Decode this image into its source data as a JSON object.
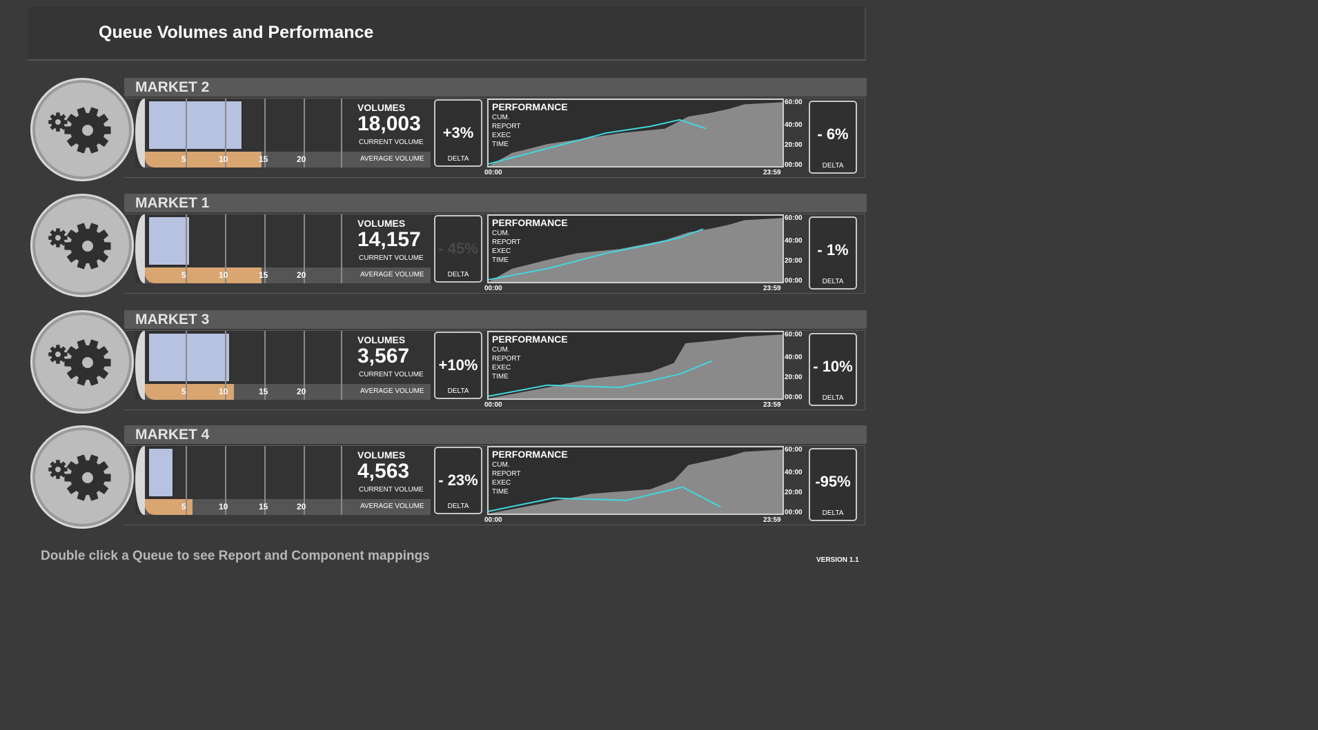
{
  "header": {
    "title": "Queue Volumes and Performance"
  },
  "labels": {
    "volumes": "VOLUMES",
    "current_volume": "CURRENT VOLUME",
    "average_volume": "AVERAGE VOLUME",
    "delta": "DELTA",
    "performance": "PERFORMANCE",
    "perf_sub": [
      "CUM.",
      "REPORT",
      "EXEC",
      "TIME"
    ],
    "ticks": [
      "5",
      "10",
      "15",
      "20"
    ],
    "y_ticks": [
      "60:00",
      "40:00",
      "20:00",
      "00:00"
    ],
    "x_ticks": [
      "00:00",
      "23:59"
    ]
  },
  "colors": {
    "current_bar": "#b7c1e0",
    "average_bar": "#d9a571",
    "area": "#8a8a8a",
    "line": "#3fd8e0"
  },
  "icons": {
    "queue": "gear-icon"
  },
  "markets": [
    {
      "name": "MARKET 2",
      "current_volume": "18,003",
      "volume_delta": "+3%",
      "perf_delta": "- 6%",
      "current_fraction": 0.345,
      "average_fraction": 0.34,
      "chart_data": {
        "type": "area",
        "x_range": [
          "00:00",
          "23:59"
        ],
        "y_ticks": [
          "00:00",
          "20:00",
          "40:00",
          "60:00"
        ],
        "area_points": [
          [
            0,
            0
          ],
          [
            8,
            12
          ],
          [
            20,
            20
          ],
          [
            30,
            24
          ],
          [
            45,
            30
          ],
          [
            60,
            34
          ],
          [
            68,
            45
          ],
          [
            75,
            48
          ],
          [
            82,
            52
          ],
          [
            87,
            56
          ],
          [
            100,
            58
          ]
        ],
        "line_points": [
          [
            0,
            2
          ],
          [
            20,
            16
          ],
          [
            40,
            30
          ],
          [
            55,
            36
          ],
          [
            65,
            42
          ],
          [
            74,
            34
          ]
        ]
      }
    },
    {
      "name": "MARKET 1",
      "current_volume": "14,157",
      "volume_delta": "- 45%",
      "perf_delta": "- 1%",
      "current_fraction": 0.155,
      "average_fraction": 0.34,
      "chart_data": {
        "type": "area",
        "x_range": [
          "00:00",
          "23:59"
        ],
        "y_ticks": [
          "00:00",
          "20:00",
          "40:00",
          "60:00"
        ],
        "area_points": [
          [
            0,
            0
          ],
          [
            8,
            12
          ],
          [
            20,
            20
          ],
          [
            30,
            26
          ],
          [
            45,
            30
          ],
          [
            60,
            38
          ],
          [
            68,
            45
          ],
          [
            75,
            48
          ],
          [
            82,
            52
          ],
          [
            87,
            56
          ],
          [
            100,
            58
          ]
        ],
        "line_points": [
          [
            0,
            2
          ],
          [
            20,
            12
          ],
          [
            40,
            26
          ],
          [
            55,
            34
          ],
          [
            65,
            40
          ],
          [
            73,
            48
          ]
        ]
      }
    },
    {
      "name": "MARKET 3",
      "current_volume": "3,567",
      "volume_delta": "+10%",
      "perf_delta": "- 10%",
      "current_fraction": 0.3,
      "average_fraction": 0.26,
      "chart_data": {
        "type": "area",
        "x_range": [
          "00:00",
          "23:59"
        ],
        "y_ticks": [
          "00:00",
          "20:00",
          "40:00",
          "60:00"
        ],
        "area_points": [
          [
            0,
            0
          ],
          [
            8,
            4
          ],
          [
            20,
            10
          ],
          [
            35,
            18
          ],
          [
            55,
            24
          ],
          [
            63,
            32
          ],
          [
            67,
            50
          ],
          [
            75,
            52
          ],
          [
            82,
            54
          ],
          [
            87,
            56
          ],
          [
            100,
            58
          ]
        ],
        "line_points": [
          [
            0,
            2
          ],
          [
            20,
            12
          ],
          [
            45,
            10
          ],
          [
            65,
            22
          ],
          [
            76,
            34
          ]
        ]
      }
    },
    {
      "name": "MARKET 4",
      "current_volume": "4,563",
      "volume_delta": "- 23%",
      "perf_delta": "-95%",
      "current_fraction": 0.095,
      "average_fraction": 0.14,
      "chart_data": {
        "type": "area",
        "x_range": [
          "00:00",
          "23:59"
        ],
        "y_ticks": [
          "00:00",
          "20:00",
          "40:00",
          "60:00"
        ],
        "area_points": [
          [
            0,
            0
          ],
          [
            8,
            4
          ],
          [
            20,
            10
          ],
          [
            35,
            18
          ],
          [
            55,
            22
          ],
          [
            63,
            30
          ],
          [
            68,
            44
          ],
          [
            75,
            48
          ],
          [
            82,
            52
          ],
          [
            87,
            56
          ],
          [
            100,
            58
          ]
        ],
        "line_points": [
          [
            0,
            2
          ],
          [
            22,
            14
          ],
          [
            47,
            12
          ],
          [
            66,
            24
          ],
          [
            79,
            6
          ]
        ]
      }
    }
  ],
  "footer": {
    "hint": "Double click a Queue to see Report and Component mappings",
    "version": "VERSION 1.1"
  }
}
